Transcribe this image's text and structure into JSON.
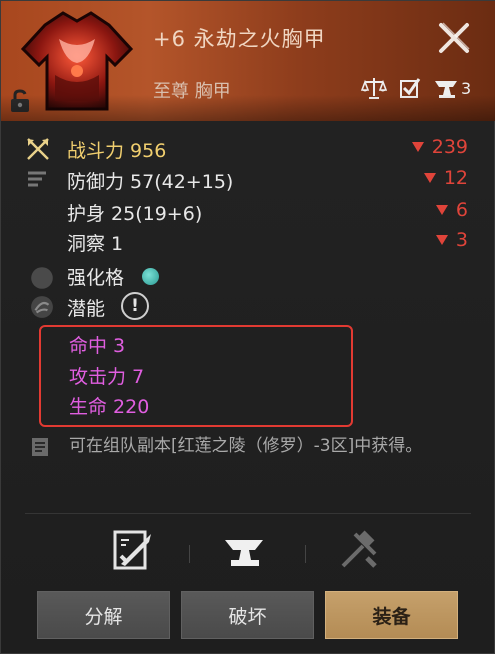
{
  "item": {
    "title": "+6 永劫之火胸甲",
    "subtitle": "至尊 胸甲",
    "icon_name": "armor-chest-icon",
    "lock_icon": "unlock-icon",
    "anvil_count": "3"
  },
  "stats": [
    {
      "label": "战斗力 956",
      "delta": "239",
      "icon": "crossed-swords-icon"
    },
    {
      "label": "防御力 57(42+15)",
      "delta": "12",
      "icon": "list-lines-icon"
    },
    {
      "label": "护身 25(19+6)",
      "delta": "6",
      "icon": ""
    },
    {
      "label": "洞察 1",
      "delta": "3",
      "icon": ""
    }
  ],
  "sockets": {
    "enhance_label": "强化格",
    "potential_label": "潜能",
    "potential_mark": "!"
  },
  "affixes": [
    "命中 3",
    "攻击力 7",
    "生命 220"
  ],
  "source": "可在组队副本[红莲之陵（修罗）-3区]中获得。",
  "buttons": {
    "dismantle": "分解",
    "destroy": "破坏",
    "equip": "装备"
  },
  "colors": {
    "delta_down": "#e0443a",
    "affix": "#e05ee0",
    "combat_power": "#f1cf6f",
    "equip_button": "#c5a06b"
  }
}
